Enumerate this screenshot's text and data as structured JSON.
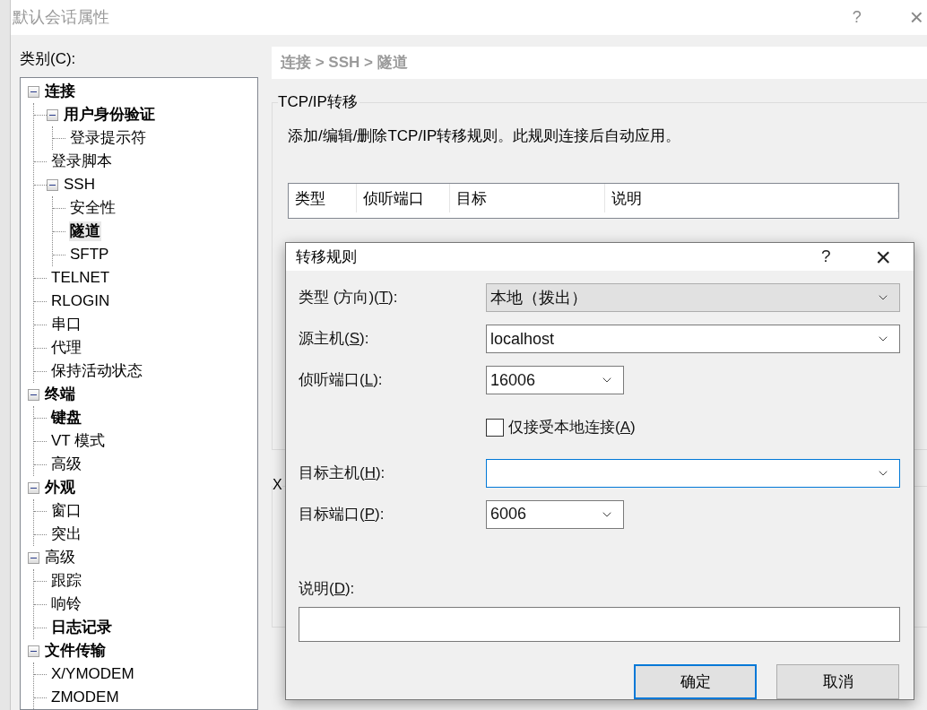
{
  "window": {
    "title": "默认会话属性",
    "help": "?",
    "close": "×"
  },
  "category_label": "类别(C):",
  "tree": [
    {
      "label": "连接",
      "bold": true,
      "selected": false,
      "expanded": true,
      "children": [
        {
          "label": "用户身份验证",
          "bold": true,
          "selected": false,
          "expanded": true,
          "children": [
            {
              "label": "登录提示符",
              "bold": false,
              "selected": false
            }
          ]
        },
        {
          "label": "登录脚本",
          "bold": false,
          "selected": false
        },
        {
          "label": "SSH",
          "bold": false,
          "selected": false,
          "expanded": true,
          "children": [
            {
              "label": "安全性",
              "bold": false,
              "selected": false
            },
            {
              "label": "隧道",
              "bold": true,
              "selected": true
            },
            {
              "label": "SFTP",
              "bold": false,
              "selected": false
            }
          ]
        },
        {
          "label": "TELNET",
          "bold": false,
          "selected": false
        },
        {
          "label": "RLOGIN",
          "bold": false,
          "selected": false
        },
        {
          "label": "串口",
          "bold": false,
          "selected": false
        },
        {
          "label": "代理",
          "bold": false,
          "selected": false
        },
        {
          "label": "保持活动状态",
          "bold": false,
          "selected": false
        }
      ]
    },
    {
      "label": "终端",
      "bold": true,
      "selected": false,
      "expanded": true,
      "children": [
        {
          "label": "键盘",
          "bold": true,
          "selected": false
        },
        {
          "label": "VT 模式",
          "bold": false,
          "selected": false
        },
        {
          "label": "高级",
          "bold": false,
          "selected": false
        }
      ]
    },
    {
      "label": "外观",
      "bold": true,
      "selected": false,
      "expanded": true,
      "children": [
        {
          "label": "窗口",
          "bold": false,
          "selected": false
        },
        {
          "label": "突出",
          "bold": false,
          "selected": false
        }
      ]
    },
    {
      "label": "高级",
      "bold": false,
      "selected": false,
      "expanded": true,
      "children": [
        {
          "label": "跟踪",
          "bold": false,
          "selected": false
        },
        {
          "label": "响铃",
          "bold": false,
          "selected": false
        },
        {
          "label": "日志记录",
          "bold": true,
          "selected": false
        }
      ]
    },
    {
      "label": "文件传输",
      "bold": true,
      "selected": false,
      "expanded": true,
      "children": [
        {
          "label": "X/YMODEM",
          "bold": false,
          "selected": false
        },
        {
          "label": "ZMODEM",
          "bold": false,
          "selected": false
        }
      ]
    }
  ],
  "breadcrumb": "连接 > SSH > 隧道",
  "group": {
    "title": "TCP/IP转移",
    "description": "添加/编辑/删除TCP/IP转移规则。此规则连接后自动应用。",
    "table": {
      "columns": [
        "类型",
        "侦听端口",
        "目标",
        "说明"
      ]
    }
  },
  "group2": {
    "title": "X"
  },
  "dialog": {
    "title": "转移规则",
    "help": "?",
    "close": "×",
    "fields": [
      {
        "kind": "combo",
        "label_before": "类型 (方向)(",
        "accel": "T",
        "label_after": "):",
        "value": "本地（拨出）",
        "readonly": true,
        "wide": true,
        "focused": false
      },
      {
        "kind": "combo",
        "label_before": "源主机(",
        "accel": "S",
        "label_after": "):",
        "value": "localhost",
        "readonly": false,
        "wide": true,
        "focused": false
      },
      {
        "kind": "combo",
        "label_before": "侦听端口(",
        "accel": "L",
        "label_after": "):",
        "value": "16006",
        "readonly": false,
        "wide": false,
        "focused": false
      },
      {
        "kind": "checkbox",
        "label_before": "仅接受本地连接(",
        "accel": "A",
        "label_after": ")",
        "checked": false
      },
      {
        "kind": "combo",
        "label_before": "目标主机(",
        "accel": "H",
        "label_after": "):",
        "readonly": false,
        "wide": true,
        "focused": true
      },
      {
        "kind": "combo",
        "label_before": "目标端口(",
        "accel": "P",
        "label_after": "):",
        "value": "6006",
        "readonly": false,
        "wide": false,
        "focused": false
      },
      {
        "kind": "text",
        "label_before": "说明(",
        "accel": "D",
        "label_after": "):"
      }
    ],
    "buttons": [
      {
        "label": "确定",
        "default": true
      },
      {
        "label": "取消",
        "default": false
      }
    ]
  }
}
